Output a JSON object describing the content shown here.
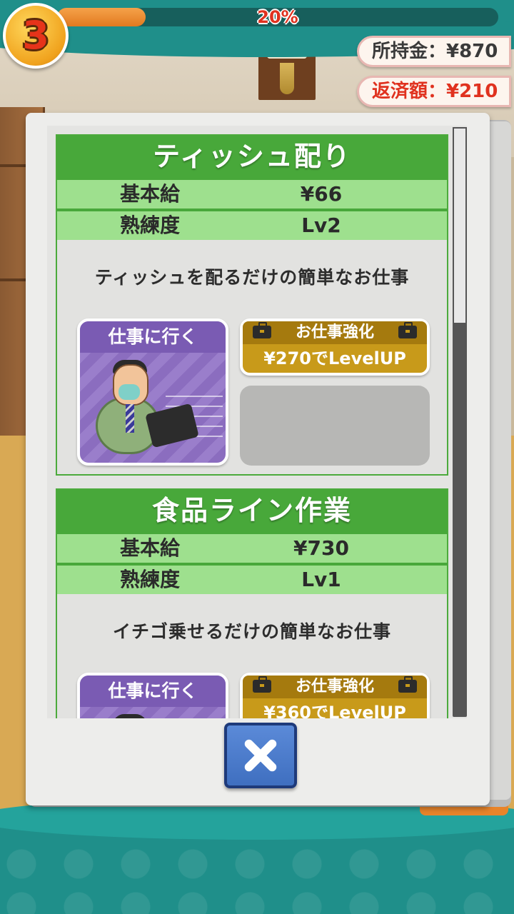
{
  "hud": {
    "level": "3",
    "progress_percent": 20,
    "progress_label": "20%",
    "money_owned": "所持金：¥870",
    "repayment": "返済額：¥210"
  },
  "jobs": [
    {
      "title": "ティッシュ配り",
      "salary_label": "基本給",
      "salary": "¥66",
      "skill_label": "熟練度",
      "skill": "Lv2",
      "description": "ティッシュを配るだけの簡単なお仕事",
      "go_label": "仕事に行く",
      "upgrade_title": "お仕事強化",
      "upgrade_price": "¥270でLevelUP"
    },
    {
      "title": "食品ライン作業",
      "salary_label": "基本給",
      "salary": "¥730",
      "skill_label": "熟練度",
      "skill": "Lv1",
      "description": "イチゴ乗せるだけの簡単なお仕事",
      "go_label": "仕事に行く",
      "upgrade_title": "お仕事強化",
      "upgrade_price": "¥360でLevelUP"
    }
  ],
  "colors": {
    "card_green": "#48a83a",
    "row_green": "#9ee08e",
    "go_purple": "#8b6dbf",
    "upgrade_gold": "#c89a1a",
    "close_blue": "#3f6fc0"
  },
  "icons": [
    "briefcase-icon",
    "close-icon"
  ]
}
